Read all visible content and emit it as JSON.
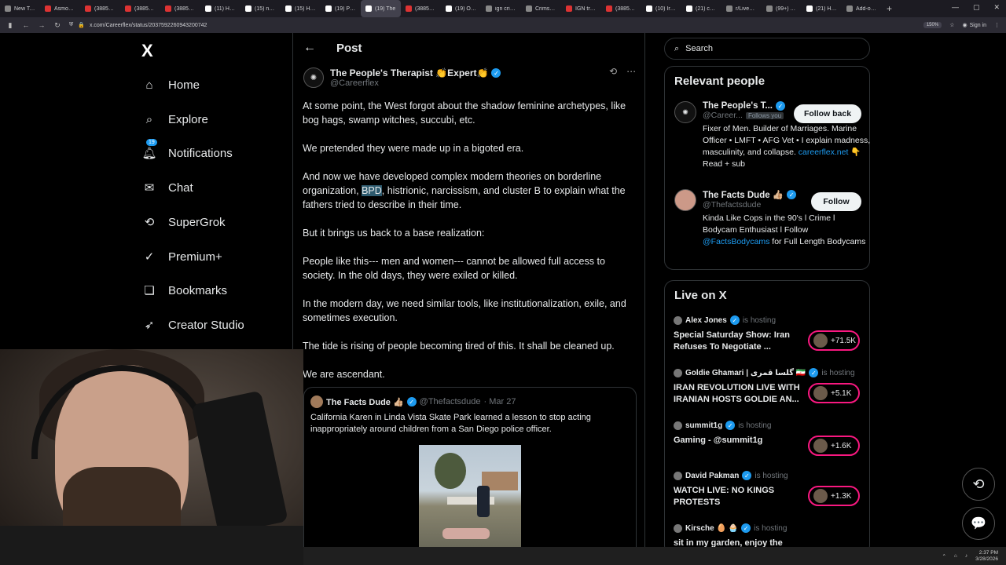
{
  "browser": {
    "tabs": [
      {
        "label": "New Tab",
        "icon": "firefox-icon"
      },
      {
        "label": "Asmongold",
        "icon": "youtube-icon"
      },
      {
        "label": "(3885) TOP",
        "icon": "youtube-icon"
      },
      {
        "label": "(3885) criti",
        "icon": "youtube-icon"
      },
      {
        "label": "(3885) This",
        "icon": "youtube-icon"
      },
      {
        "label": "(11) Home",
        "icon": "x-icon"
      },
      {
        "label": "(15) no kin",
        "icon": "x-icon"
      },
      {
        "label": "(15) Home",
        "icon": "x-icon"
      },
      {
        "label": "(19) Posts",
        "icon": "x-icon"
      },
      {
        "label": "(19) The",
        "icon": "x-icon",
        "active": true
      },
      {
        "label": "(3885) Not",
        "icon": "youtube-icon"
      },
      {
        "label": "(19) OSINT",
        "icon": "x-icon"
      },
      {
        "label": "ign crimso",
        "icon": "google-icon"
      },
      {
        "label": "Crimson D",
        "icon": "game-icon"
      },
      {
        "label": "IGN trying",
        "icon": "youtube-icon"
      },
      {
        "label": "(3885) Holi",
        "icon": "youtube-icon"
      },
      {
        "label": "(10) Iran N",
        "icon": "x-icon"
      },
      {
        "label": "(21) caleb",
        "icon": "x-icon"
      },
      {
        "label": "r/Livestrea",
        "icon": "reddit-icon"
      },
      {
        "label": "(99+) All C",
        "icon": "twitch-icon"
      },
      {
        "label": "(21) Home",
        "icon": "x-icon"
      },
      {
        "label": "Add-ons N",
        "icon": "puzzle-icon"
      }
    ],
    "new_tab": "+",
    "url": "x.com/Careerflex/status/2037592260943200742",
    "zoom": "150%",
    "sign_in": "Sign in"
  },
  "nav": {
    "logo": "X",
    "items": [
      {
        "label": "Home",
        "icon": "home-icon"
      },
      {
        "label": "Explore",
        "icon": "search-icon"
      },
      {
        "label": "Notifications",
        "icon": "bell-icon",
        "badge": "19"
      },
      {
        "label": "Chat",
        "icon": "mail-icon"
      },
      {
        "label": "SuperGrok",
        "icon": "grok-icon"
      },
      {
        "label": "Premium+",
        "icon": "verified-icon"
      },
      {
        "label": "Bookmarks",
        "icon": "bookmark-icon"
      },
      {
        "label": "Creator Studio",
        "icon": "rocket-icon"
      }
    ]
  },
  "post": {
    "header_title": "Post",
    "author_name": "The People's Therapist 👏Expert👏",
    "author_handle": "@Careerflex",
    "paragraphs": [
      "At some point, the West forgot about the shadow feminine archetypes, like bog hags, swamp witches, succubi, etc.",
      "We pretended they were made up in a bigoted era.",
      "And now we have developed complex modern theories on borderline organization, ",
      "But it brings us back to a base realization:",
      "People like this--- men and women--- cannot be allowed full access to society. In the old days, they were exiled or killed.",
      "In the modern day, we need similar tools, like institutionalization,  exile, and sometimes execution.",
      "The tide is rising of people becoming tired of this. It shall be cleaned up.",
      "We are ascendant."
    ],
    "highlight": "BPD",
    "para3_rest": ", histrionic, narcissism, and cluster B to explain what the fathers tried to describe in their time.",
    "quote": {
      "name": "The Facts Dude 👍🏼",
      "handle": "@Thefactsdude",
      "date": "· Mar 27",
      "text": "California Karen in Linda Vista Skate Park learned a lesson to stop acting inappropriately around children from a San Diego police officer."
    }
  },
  "right": {
    "search_placeholder": "Search",
    "relevant_title": "Relevant people",
    "people": [
      {
        "name": "The People's T...",
        "handle": "@Career...",
        "follows_you": "Follows you",
        "button": "Follow back",
        "bio": "Fixer of Men. Builder of Marriages. Marine Officer • LMFT • AFG Vet • I explain madness, masculinity, and collapse. ",
        "bio_link": "careerflex.net",
        "bio_tail": " 👇 Read + sub"
      },
      {
        "name": "The Facts Dude 👍🏼",
        "handle": "@Thefactsdude",
        "button": "Follow",
        "bio": "Kinda Like Cops in the 90's l Crime l Bodycam Enthusiast l Follow ",
        "bio_link": "@FactsBodycams",
        "bio_tail": " for Full Length Bodycams"
      }
    ],
    "live_title": "Live on X",
    "live": [
      {
        "host": "Alex Jones",
        "status": "is hosting",
        "title": "Special Saturday Show: Iran Refuses To Negotiate ...",
        "count": "+71.5K"
      },
      {
        "host": "Goldie Ghamari | گلسا قمری 🇮🇷",
        "status": "is hosting",
        "title": "IRAN REVOLUTION LIVE WITH IRANIAN HOSTS GOLDIE AN...",
        "count": "+5.1K"
      },
      {
        "host": "summit1g",
        "status": "is hosting",
        "title": "Gaming - @summit1g",
        "count": "+1.6K"
      },
      {
        "host": "David Pakman",
        "status": "is hosting",
        "title": "WATCH LIVE: NO KINGS PROTESTS",
        "count": "+1.3K"
      },
      {
        "host": "Kirsche 🥚 🧁",
        "status": "is hosting",
        "title": "sit in my garden, enjoy the",
        "count": ""
      }
    ]
  },
  "taskbar": {
    "time": "2:37 PM",
    "date": "3/28/2026"
  }
}
